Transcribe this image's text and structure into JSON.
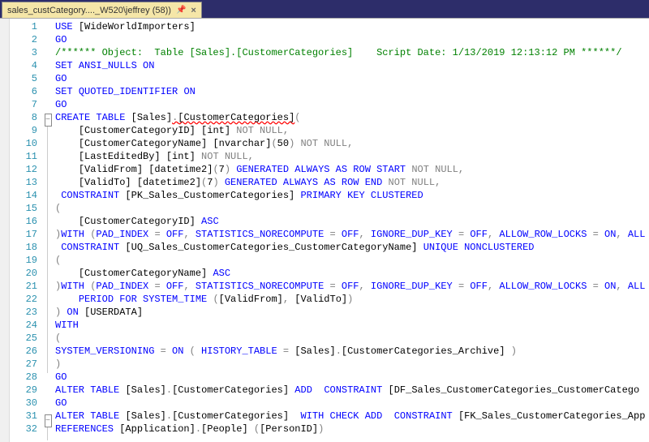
{
  "tab": {
    "label": "sales_custCategory...._W520\\jeffrey (58))"
  },
  "fold": {
    "minus": "−"
  },
  "lines": [
    {
      "n": 1,
      "fold": "",
      "html": "<span class='kw'>USE</span> <span class='txt'>[WideWorldImporters]</span>"
    },
    {
      "n": 2,
      "fold": "",
      "html": "<span class='kw'>GO</span>"
    },
    {
      "n": 3,
      "fold": "",
      "html": "<span class='cmt'>/****** Object:  Table [Sales].[CustomerCategories]    Script Date: 1/13/2019 12:13:12 PM ******/</span>"
    },
    {
      "n": 4,
      "fold": "",
      "html": "<span class='kw'>SET</span> <span class='kw'>ANSI_NULLS</span> <span class='kw'>ON</span>"
    },
    {
      "n": 5,
      "fold": "",
      "html": "<span class='kw'>GO</span>"
    },
    {
      "n": 6,
      "fold": "",
      "html": "<span class='kw'>SET</span> <span class='kw'>QUOTED_IDENTIFIER</span> <span class='kw'>ON</span>"
    },
    {
      "n": 7,
      "fold": "",
      "html": "<span class='kw'>GO</span>"
    },
    {
      "n": 8,
      "fold": "box",
      "html": "<span class='kw'>CREATE</span> <span class='kw'>TABLE</span> <span class='txt'>[Sales]</span><span class='op squiggle'>.</span><span class='txt squiggle'>[CustomerCategories]</span><span class='op'>(</span>"
    },
    {
      "n": 9,
      "fold": "line",
      "html": "    <span class='txt'>[CustomerCategoryID] [int]</span> <span class='gray'>NOT NULL,</span>"
    },
    {
      "n": 10,
      "fold": "line",
      "html": "    <span class='txt'>[CustomerCategoryName] [nvarchar]</span><span class='op'>(</span><span class='txt'>50</span><span class='op'>)</span> <span class='gray'>NOT NULL,</span>"
    },
    {
      "n": 11,
      "fold": "line",
      "html": "    <span class='txt'>[LastEditedBy] [int]</span> <span class='gray'>NOT NULL,</span>"
    },
    {
      "n": 12,
      "fold": "line",
      "html": "    <span class='txt'>[ValidFrom] [datetime2]</span><span class='op'>(</span><span class='txt'>7</span><span class='op'>)</span> <span class='kw'>GENERATED ALWAYS AS ROW START</span> <span class='gray'>NOT NULL,</span>"
    },
    {
      "n": 13,
      "fold": "line",
      "html": "    <span class='txt'>[ValidTo] [datetime2]</span><span class='op'>(</span><span class='txt'>7</span><span class='op'>)</span> <span class='kw'>GENERATED ALWAYS AS ROW END</span> <span class='gray'>NOT NULL,</span>"
    },
    {
      "n": 14,
      "fold": "line",
      "html": " <span class='kw'>CONSTRAINT</span> <span class='txt'>[PK_Sales_CustomerCategories]</span> <span class='kw'>PRIMARY KEY CLUSTERED</span>"
    },
    {
      "n": 15,
      "fold": "line",
      "html": "<span class='op'>(</span>"
    },
    {
      "n": 16,
      "fold": "line",
      "html": "    <span class='txt'>[CustomerCategoryID]</span> <span class='kw'>ASC</span>"
    },
    {
      "n": 17,
      "fold": "line",
      "html": "<span class='op'>)</span><span class='kw'>WITH</span> <span class='op'>(</span><span class='kw'>PAD_INDEX</span> <span class='op'>=</span> <span class='kw'>OFF</span><span class='op'>,</span> <span class='kw'>STATISTICS_NORECOMPUTE</span> <span class='op'>=</span> <span class='kw'>OFF</span><span class='op'>,</span> <span class='kw'>IGNORE_DUP_KEY</span> <span class='op'>=</span> <span class='kw'>OFF</span><span class='op'>,</span> <span class='kw'>ALLOW_ROW_LOCKS</span> <span class='op'>=</span> <span class='kw'>ON</span><span class='op'>,</span> <span class='kw'>ALL</span>"
    },
    {
      "n": 18,
      "fold": "line",
      "html": " <span class='kw'>CONSTRAINT</span> <span class='txt'>[UQ_Sales_CustomerCategories_CustomerCategoryName]</span> <span class='kw'>UNIQUE NONCLUSTERED</span>"
    },
    {
      "n": 19,
      "fold": "line",
      "html": "<span class='op'>(</span>"
    },
    {
      "n": 20,
      "fold": "line",
      "html": "    <span class='txt'>[CustomerCategoryName]</span> <span class='kw'>ASC</span>"
    },
    {
      "n": 21,
      "fold": "line",
      "html": "<span class='op'>)</span><span class='kw'>WITH</span> <span class='op'>(</span><span class='kw'>PAD_INDEX</span> <span class='op'>=</span> <span class='kw'>OFF</span><span class='op'>,</span> <span class='kw'>STATISTICS_NORECOMPUTE</span> <span class='op'>=</span> <span class='kw'>OFF</span><span class='op'>,</span> <span class='kw'>IGNORE_DUP_KEY</span> <span class='op'>=</span> <span class='kw'>OFF</span><span class='op'>,</span> <span class='kw'>ALLOW_ROW_LOCKS</span> <span class='op'>=</span> <span class='kw'>ON</span><span class='op'>,</span> <span class='kw'>ALL</span>"
    },
    {
      "n": 22,
      "fold": "line",
      "html": "    <span class='kw'>PERIOD FOR SYSTEM_TIME</span> <span class='op'>(</span><span class='txt'>[ValidFrom]</span><span class='op'>,</span> <span class='txt'>[ValidTo]</span><span class='op'>)</span>"
    },
    {
      "n": 23,
      "fold": "line",
      "html": "<span class='op'>)</span> <span class='kw'>ON</span> <span class='txt'>[USERDATA]</span>"
    },
    {
      "n": 24,
      "fold": "line",
      "html": "<span class='kw'>WITH</span>"
    },
    {
      "n": 25,
      "fold": "line",
      "html": "<span class='op'>(</span>"
    },
    {
      "n": 26,
      "fold": "line",
      "html": "<span class='kw'>SYSTEM_VERSIONING</span> <span class='op'>=</span> <span class='kw'>ON</span> <span class='op'>(</span> <span class='kw'>HISTORY_TABLE</span> <span class='op'>=</span> <span class='txt'>[Sales]</span><span class='op'>.</span><span class='txt'>[CustomerCategories_Archive]</span> <span class='op'>)</span>"
    },
    {
      "n": 27,
      "fold": "line",
      "html": "<span class='op'>)</span>"
    },
    {
      "n": 28,
      "fold": "",
      "html": "<span class='kw'>GO</span>"
    },
    {
      "n": 29,
      "fold": "",
      "html": "<span class='kw'>ALTER</span> <span class='kw'>TABLE</span> <span class='txt'>[Sales]</span><span class='op'>.</span><span class='txt'>[CustomerCategories]</span> <span class='kw'>ADD</span>  <span class='kw'>CONSTRAINT</span> <span class='txt'>[DF_Sales_CustomerCategories_CustomerCatego</span>"
    },
    {
      "n": 30,
      "fold": "",
      "html": "<span class='kw'>GO</span>"
    },
    {
      "n": 31,
      "fold": "box",
      "html": "<span class='kw'>ALTER</span> <span class='kw'>TABLE</span> <span class='txt'>[Sales]</span><span class='op'>.</span><span class='txt'>[CustomerCategories]</span>  <span class='kw'>WITH CHECK ADD</span>  <span class='kw'>CONSTRAINT</span> <span class='txt'>[FK_Sales_CustomerCategories_App</span>"
    },
    {
      "n": 32,
      "fold": "line",
      "html": "<span class='kw'>REFERENCES</span> <span class='txt'>[Application]</span><span class='op'>.</span><span class='txt'>[People]</span> <span class='op'>(</span><span class='txt'>[PersonID]</span><span class='op'>)</span>"
    }
  ]
}
